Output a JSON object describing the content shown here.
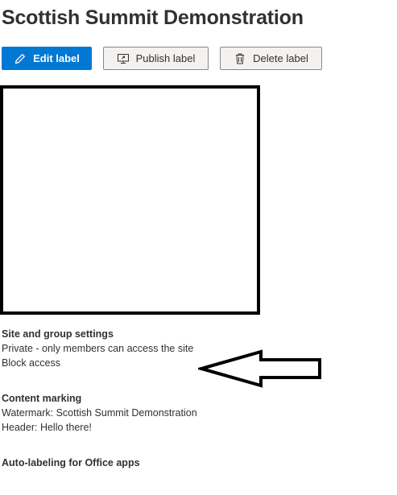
{
  "header": {
    "title": "Scottish Summit Demonstration"
  },
  "toolbar": {
    "edit_label": "Edit label",
    "publish_label": "Publish label",
    "delete_label": "Delete label"
  },
  "site_group": {
    "heading": "Site and group settings",
    "lines": [
      "Private - only members can access the site",
      "Block access"
    ]
  },
  "content_marking": {
    "heading": "Content marking",
    "lines": [
      "Watermark: Scottish Summit Demonstration",
      "Header: Hello there!"
    ]
  },
  "auto_labeling": {
    "heading": "Auto-labeling for Office apps"
  },
  "colors": {
    "accent": "#0078d4",
    "text": "#323130",
    "button_secondary_bg": "#f3f2f1"
  },
  "icons": {
    "edit": "pencil-icon",
    "publish": "publish-monitor-icon",
    "delete": "trash-icon",
    "annotation": "left-arrow-annotation"
  }
}
